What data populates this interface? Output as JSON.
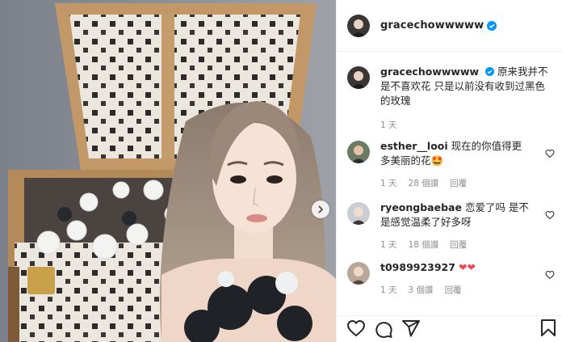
{
  "post": {
    "username": "gracechowwwww",
    "verified": true,
    "caption": "原来我并不是不喜欢花 只是以前没有收到过黑色的玫瑰",
    "caption_time": "1 天"
  },
  "comments": [
    {
      "username": "esther__looi",
      "text": "现在的你值得更多美丽的花🤩",
      "time": "1 天",
      "likes": "28 個讚",
      "reply": "回覆"
    },
    {
      "username": "ryeongbaebae",
      "text": "恋爱了吗 是不是感觉温柔了好多呀",
      "time": "1 天",
      "likes": "18 個讚",
      "reply": "回覆"
    },
    {
      "username": "t0989923927",
      "text": "❤❤",
      "time": "1 天",
      "likes": "3 個讚",
      "reply": "回覆"
    }
  ],
  "colors": {
    "verified": "#0095f6",
    "heart_red": "#ed4956",
    "muted": "#8e8e8e",
    "text": "#262626"
  },
  "icons": [
    "verified-icon",
    "heart-icon",
    "comment-icon",
    "share-icon",
    "bookmark-icon",
    "chevron-right-icon"
  ]
}
